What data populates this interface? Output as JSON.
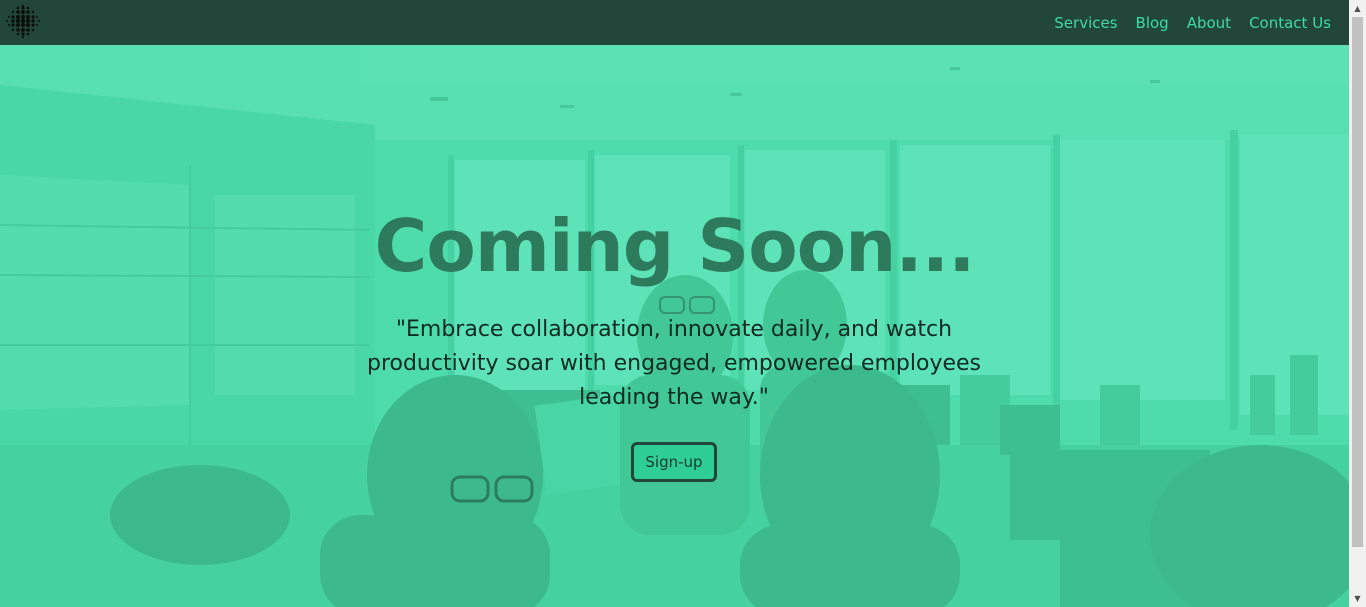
{
  "nav": {
    "logo_icon": "dotted-grid-logo",
    "links": [
      {
        "label": "Services"
      },
      {
        "label": "Blog"
      },
      {
        "label": "About"
      },
      {
        "label": "Contact Us"
      }
    ]
  },
  "hero": {
    "title": "Coming Soon...",
    "tagline": "\"Embrace collaboration, innovate daily, and watch productivity soar with engaged, empowered employees leading the way.\"",
    "signup_label": "Sign-up"
  },
  "colors": {
    "nav_bg": "#23463a",
    "accent": "#3ddba5",
    "hero_overlay": "#4fdcac",
    "title": "#2e7a5c"
  }
}
